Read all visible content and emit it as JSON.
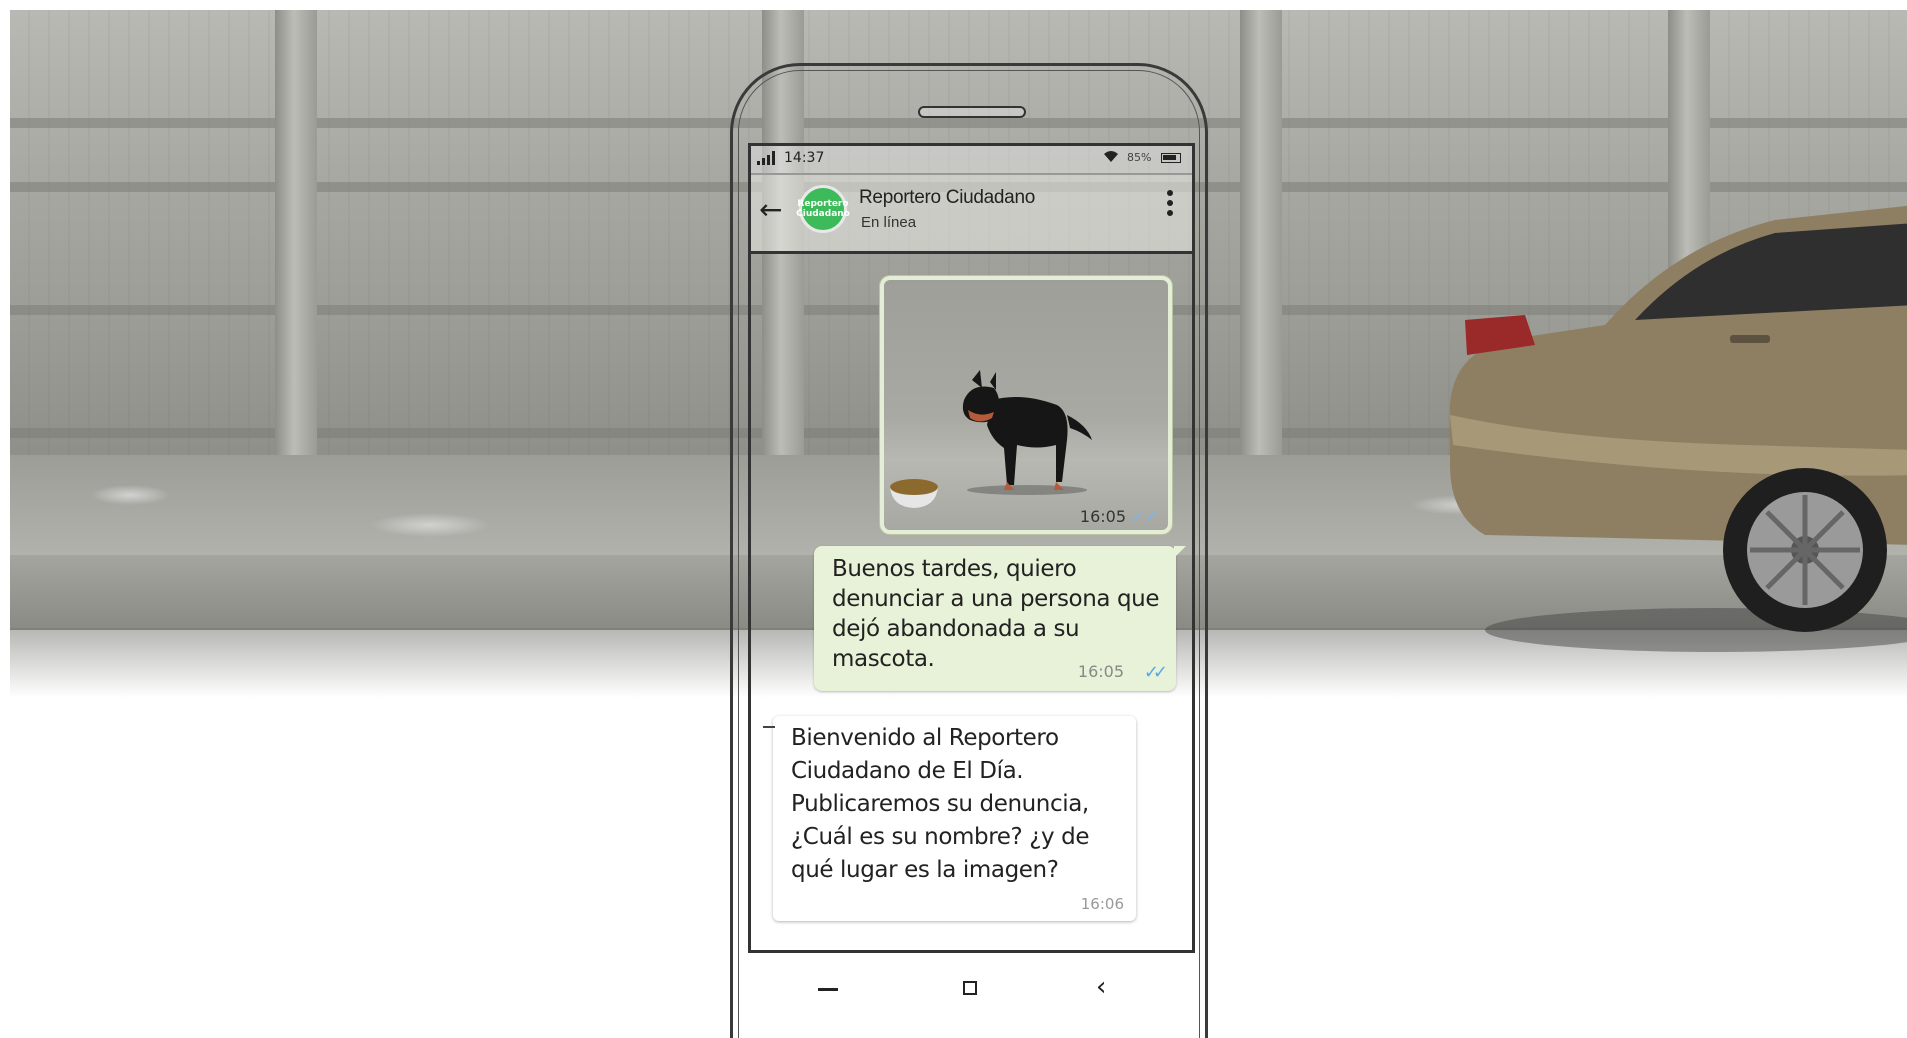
{
  "statusbar": {
    "time": "14:37",
    "battery_percent": "85%"
  },
  "chat": {
    "contact_name": "Reportero Ciudadano",
    "contact_status": "En línea",
    "avatar_text": "Reportero Ciudadano",
    "messages": [
      {
        "type": "image",
        "direction": "outgoing",
        "time": "16:05",
        "ticks": "✓✓"
      },
      {
        "type": "text",
        "direction": "outgoing",
        "text": "Buenos tardes, quiero denunciar a una persona que dejó abandonada a su mascota.",
        "time": "16:05",
        "ticks": "✓✓"
      },
      {
        "type": "text",
        "direction": "incoming",
        "text": "Bienvenido al Reportero Ciudadano de El Día. Publicaremos su denuncia, ¿Cuál es su nombre? ¿y de qué lugar es la imagen?",
        "time": "16:06"
      }
    ]
  },
  "icons": {
    "back": "arrow-left-icon",
    "menu": "more-vertical-icon",
    "wifi": "wifi-icon",
    "battery": "battery-icon",
    "signal": "signal-icon"
  },
  "colors": {
    "avatar": "#3dbb5a",
    "outgoing_bubble": "#e7f2d8",
    "incoming_bubble": "#ffffff",
    "read_ticks": "#5aa7e6"
  }
}
